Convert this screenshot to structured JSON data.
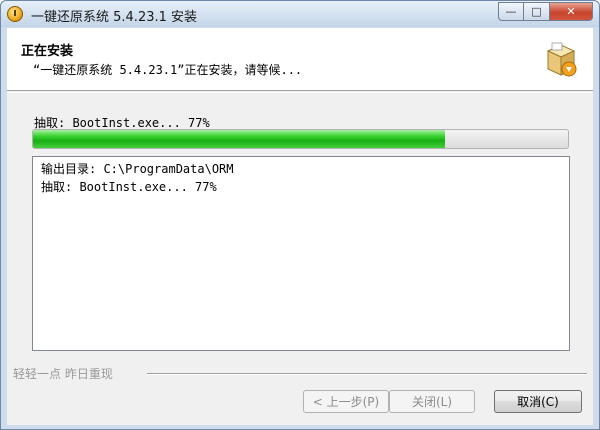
{
  "window": {
    "title": "一键还原系统 5.4.23.1 安装",
    "caption_buttons": {
      "minimize": "—",
      "maximize": "□",
      "close": "✕"
    }
  },
  "header": {
    "title": "正在安装",
    "subtitle": "“一键还原系统 5.4.23.1”正在安装，请等候...",
    "icon": "install-box-icon"
  },
  "progress": {
    "status": "抽取: BootInst.exe... 77%",
    "percent": 77,
    "color": "#26c41f"
  },
  "log": {
    "lines": [
      "输出目录: C:\\ProgramData\\ORM",
      "抽取: BootInst.exe... 77%"
    ]
  },
  "branding": {
    "text": "轻轻一点 昨日重现"
  },
  "buttons": {
    "back": "< 上一步(P)",
    "close": "关闭(L)",
    "cancel": "取消(C)"
  }
}
